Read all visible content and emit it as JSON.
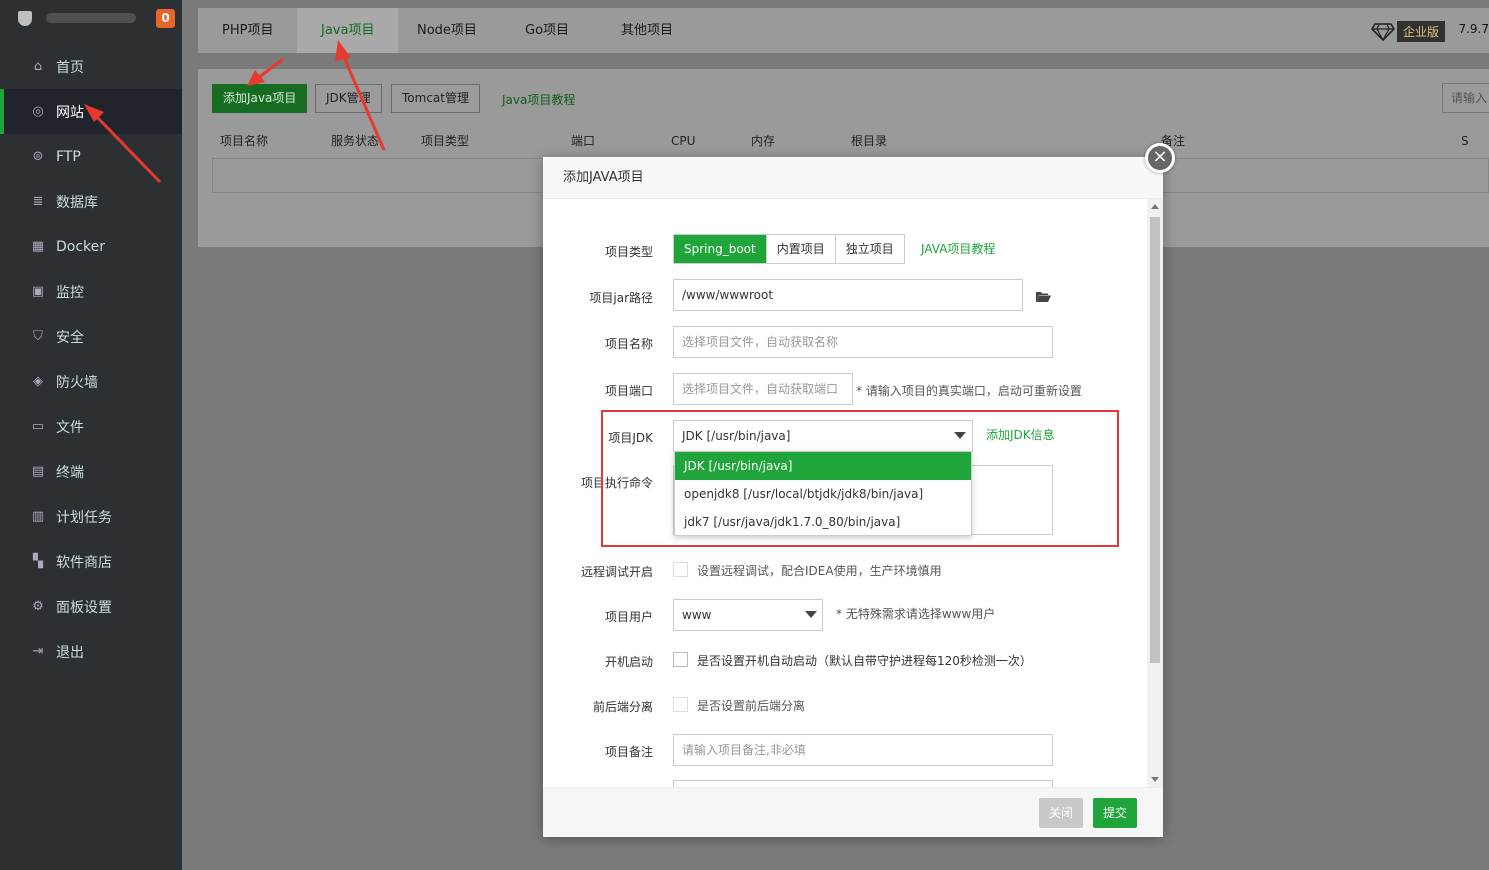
{
  "sidebar": {
    "notification_count": "0",
    "items": [
      {
        "label": "首页",
        "icon": "home-icon"
      },
      {
        "label": "网站",
        "icon": "globe-icon"
      },
      {
        "label": "FTP",
        "icon": "ftp-icon"
      },
      {
        "label": "数据库",
        "icon": "database-icon"
      },
      {
        "label": "Docker",
        "icon": "docker-icon"
      },
      {
        "label": "监控",
        "icon": "monitor-icon"
      },
      {
        "label": "安全",
        "icon": "shield-check-icon"
      },
      {
        "label": "防火墙",
        "icon": "firewall-icon"
      },
      {
        "label": "文件",
        "icon": "folder-icon"
      },
      {
        "label": "终端",
        "icon": "terminal-icon"
      },
      {
        "label": "计划任务",
        "icon": "calendar-icon"
      },
      {
        "label": "软件商店",
        "icon": "apps-icon"
      },
      {
        "label": "面板设置",
        "icon": "gear-icon"
      },
      {
        "label": "退出",
        "icon": "logout-icon"
      }
    ]
  },
  "topbar": {
    "tabs": [
      "PHP项目",
      "Java项目",
      "Node项目",
      "Go项目",
      "其他项目"
    ],
    "edition": "企业版",
    "version": "7.9.7"
  },
  "toolbar": {
    "add_java": "添加Java项目",
    "jdk_manage": "JDK管理",
    "tomcat_manage": "Tomcat管理",
    "tutorial": "Java项目教程",
    "search_placeholder": "请输入"
  },
  "table": {
    "headers": [
      "项目名称",
      "服务状态",
      "项目类型",
      "端口",
      "CPU",
      "内存",
      "根目录",
      "备注",
      "S"
    ]
  },
  "dialog": {
    "title": "添加JAVA项目",
    "project_type_label": "项目类型",
    "project_types": [
      "Spring_boot",
      "内置项目",
      "独立项目"
    ],
    "tutorial_link": "JAVA项目教程",
    "jar_path_label": "项目jar路径",
    "jar_path_value": "/www/wwwroot",
    "name_label": "项目名称",
    "name_placeholder": "选择项目文件，自动获取名称",
    "port_label": "项目端口",
    "port_placeholder": "选择项目文件，自动获取端口",
    "port_hint": "* 请输入项目的真实端口，启动可重新设置",
    "jdk_label": "项目JDK",
    "jdk_value": "JDK [/usr/bin/java]",
    "add_jdk_link": "添加JDK信息",
    "jdk_options": [
      "JDK [/usr/bin/java]",
      "openjdk8 [/usr/local/btjdk/jdk8/bin/java]",
      "jdk7 [/usr/java/jdk1.7.0_80/bin/java]"
    ],
    "cmd_label": "项目执行命令",
    "debug_label": "远程调试开启",
    "debug_hint": "设置远程调试，配合IDEA使用，生产环境慎用",
    "user_label": "项目用户",
    "user_value": "www",
    "user_hint": "* 无特殊需求请选择www用户",
    "boot_label": "开机启动",
    "boot_hint": "是否设置开机自动启动（默认自带守护进程每120秒检测一次）",
    "separate_label": "前后端分离",
    "separate_hint": "是否设置前后端分离",
    "remark_label": "项目备注",
    "remark_placeholder": "请输入项目备注,非必填",
    "close_btn": "关闭",
    "submit_btn": "提交"
  },
  "colors": {
    "accent": "#20a53a",
    "highlight": "#e3353a",
    "sidebar": "#2c3033"
  }
}
